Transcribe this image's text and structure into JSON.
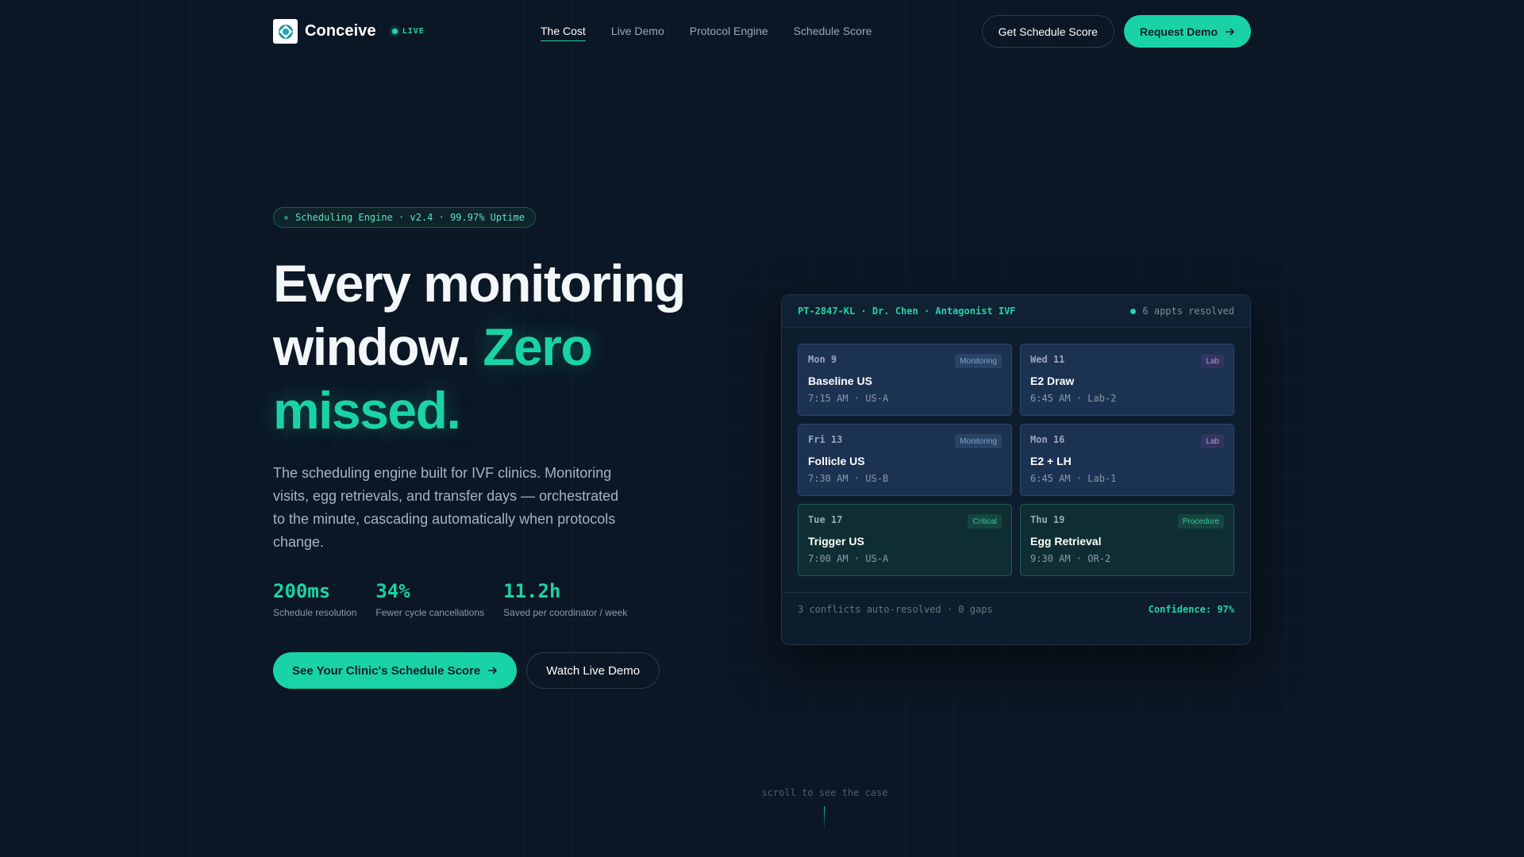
{
  "nav": {
    "brand": "Conceive",
    "live_label": "LIVE",
    "links": [
      "The Cost",
      "Live Demo",
      "Protocol Engine",
      "Schedule Score"
    ],
    "secondary_button": "Get Schedule Score",
    "primary_button": "Request Demo"
  },
  "hero": {
    "badge": "Scheduling Engine · v2.4 · 99.97% Uptime",
    "headline_line1": "Every monitoring",
    "headline_line2a": "window.",
    "headline_line2b": "Zero",
    "headline_line3": "missed.",
    "description": "The scheduling engine built for IVF clinics. Monitoring visits, egg retrievals, and transfer days — orchestrated to the minute, cascading automatically when protocols change.",
    "stats": [
      {
        "value": "200ms",
        "label": "Schedule resolution"
      },
      {
        "value": "34%",
        "label": "Fewer cycle cancellations"
      },
      {
        "value": "11.2h",
        "label": "Saved per coordinator / week"
      }
    ],
    "primary_cta": "See Your Clinic's Schedule Score",
    "secondary_cta": "Watch Live Demo"
  },
  "panel": {
    "title": "PT-2847-KL · Dr. Chen · Antagonist IVF",
    "status": "6 appts resolved",
    "appointments": [
      {
        "day": "Mon 9",
        "title": "Baseline US",
        "time": "7:15 AM",
        "location": "US-A",
        "tag": "Monitoring"
      },
      {
        "day": "Wed 11",
        "title": "E2 Draw",
        "time": "6:45 AM",
        "location": "Lab-2",
        "tag": "Lab"
      },
      {
        "day": "Fri 13",
        "title": "Follicle US",
        "time": "7:30 AM",
        "location": "US-B",
        "tag": "Monitoring"
      },
      {
        "day": "Mon 16",
        "title": "E2 + LH",
        "time": "6:45 AM",
        "location": "Lab-1",
        "tag": "Lab"
      },
      {
        "day": "Tue 17",
        "title": "Trigger US",
        "time": "7:00 AM",
        "location": "US-A",
        "tag": "Critical"
      },
      {
        "day": "Thu 19",
        "title": "Egg Retrieval",
        "time": "9:30 AM",
        "location": "OR-2",
        "tag": "Procedure"
      }
    ],
    "footer_left": "3 conflicts auto-resolved · 0 gaps",
    "footer_right": "Confidence: 97%"
  },
  "scroll_hint": "scroll to see the case",
  "colors": {
    "accent": "#19d3a6",
    "background": "#0b1724",
    "card_blue": "#1c3253",
    "card_green": "#0f2e33"
  }
}
